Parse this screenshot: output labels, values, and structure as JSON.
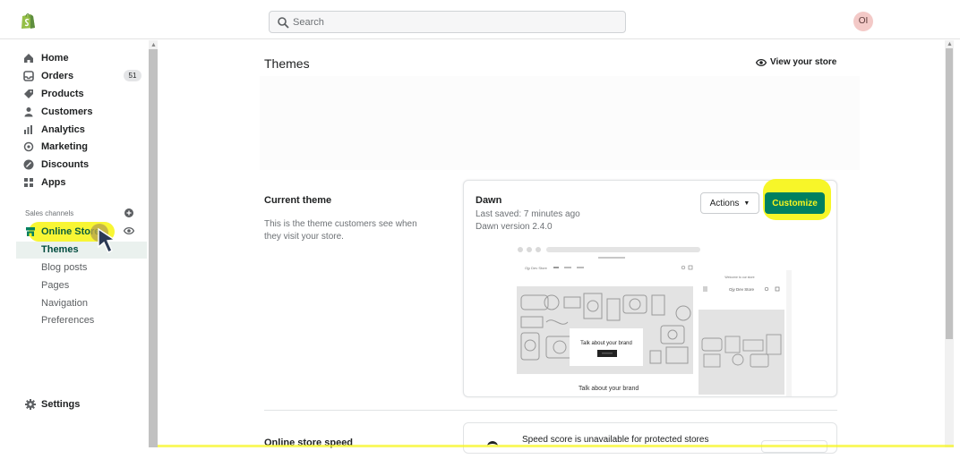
{
  "topbar": {
    "search_placeholder": "Search",
    "avatar_initials": "OI"
  },
  "sidebar": {
    "items": [
      {
        "label": "Home",
        "icon": "home-icon"
      },
      {
        "label": "Orders",
        "icon": "orders-icon",
        "badge": "51"
      },
      {
        "label": "Products",
        "icon": "tag-icon"
      },
      {
        "label": "Customers",
        "icon": "person-icon"
      },
      {
        "label": "Analytics",
        "icon": "bar-chart-icon"
      },
      {
        "label": "Marketing",
        "icon": "target-icon"
      },
      {
        "label": "Discounts",
        "icon": "discount-icon"
      },
      {
        "label": "Apps",
        "icon": "apps-icon"
      }
    ],
    "sales_channels_label": "Sales channels",
    "online_store_label": "Online Store",
    "subnav": [
      "Themes",
      "Blog posts",
      "Pages",
      "Navigation",
      "Preferences"
    ],
    "settings_label": "Settings"
  },
  "main": {
    "page_title": "Themes",
    "view_store_label": "View your store",
    "current_theme": {
      "section_title": "Current theme",
      "section_description": "This is the theme customers see when they visit your store.",
      "theme_name": "Dawn",
      "last_saved": "Last saved: 7 minutes ago",
      "version": "Dawn version 2.4.0",
      "actions_label": "Actions",
      "customize_label": "Customize",
      "preview_store_name": "Ojy Dev Store",
      "preview_banner": "Welcome to our store",
      "preview_overlay_text": "Talk about your brand",
      "preview_caption": "Talk about your brand"
    },
    "store_speed": {
      "section_title": "Online store speed",
      "message": "Speed score is unavailable for protected stores"
    }
  },
  "colors": {
    "highlight": "#f7f51e",
    "primary_button": "#008060",
    "active_nav": "#0b5e3d"
  }
}
